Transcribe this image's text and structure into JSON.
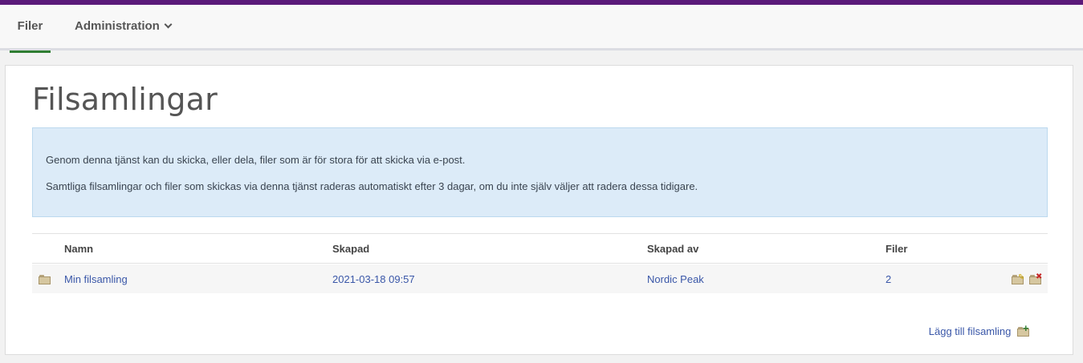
{
  "nav": {
    "files_label": "Filer",
    "admin_label": "Administration"
  },
  "page": {
    "title": "Filsamlingar"
  },
  "info": {
    "line1": "Genom denna tjänst kan du skicka, eller dela, filer som är för stora för att skicka via e-post.",
    "line2": "Samtliga filsamlingar och filer som skickas via denna tjänst raderas automatiskt efter 3 dagar, om du inte själv väljer att radera dessa tidigare."
  },
  "table": {
    "headers": [
      "Namn",
      "Skapad",
      "Skapad av",
      "Filer"
    ],
    "rows": [
      {
        "name": "Min filsamling",
        "created": "2021-03-18 09:57",
        "created_by": "Nordic Peak",
        "files": "2"
      }
    ]
  },
  "actions": {
    "add_label": "Lägg till filsamling"
  },
  "icons": {
    "row_icon": "folder-icon",
    "edit": "folder-edit-icon",
    "delete": "folder-delete-icon",
    "add": "folder-add-icon"
  },
  "colors": {
    "top_accent": "#5b1a7a",
    "active_tab": "#2e7d32",
    "link": "#3a57a8",
    "info_bg": "#dcebf8"
  }
}
